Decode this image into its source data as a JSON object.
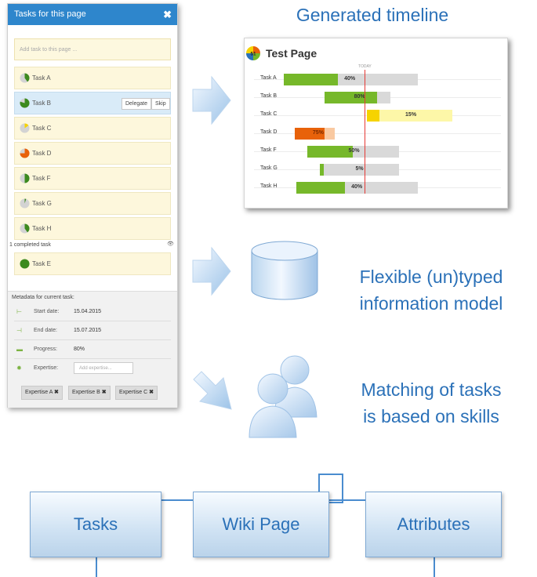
{
  "panel": {
    "title": "Tasks for this page",
    "add_placeholder": "Add task to this page ...",
    "tasks": [
      {
        "name": "Task A",
        "progress": 40
      },
      {
        "name": "Task B",
        "progress": 80,
        "delegate": "Delegate",
        "skip": "Skip"
      },
      {
        "name": "Task C",
        "progress": 15
      },
      {
        "name": "Task D",
        "progress": 75
      },
      {
        "name": "Task F",
        "progress": 50
      },
      {
        "name": "Task G",
        "progress": 5
      },
      {
        "name": "Task H",
        "progress": 40
      }
    ],
    "completed_label": "1 completed task",
    "completed_task": {
      "name": "Task E",
      "progress": 100
    },
    "meta": {
      "title": "Metadata for current task:",
      "start_label": "Start date:",
      "start_value": "15.04.2015",
      "end_label": "End date:",
      "end_value": "15.07.2015",
      "progress_label": "Progress:",
      "progress_value": "80%",
      "expertise_label": "Expertise:",
      "expertise_placeholder": "Add expertise...",
      "tags": [
        "Expertise A",
        "Expertise B",
        "Expertise C"
      ]
    }
  },
  "headings": {
    "timeline": "Generated timeline",
    "model_line1": "Flexible (un)typed",
    "model_line2": "information model",
    "skills_line1": "Matching of tasks",
    "skills_line2": "is based on skills"
  },
  "timeline": {
    "title": "Test Page",
    "badge": "51",
    "today_label": "TODAY",
    "tasks": [
      {
        "name": "Task A",
        "start": 0.0,
        "end": 0.63,
        "progress": 40,
        "label": "40%",
        "bar": "#76b82a",
        "track": "#d9d9d9"
      },
      {
        "name": "Task B",
        "start": 0.19,
        "end": 0.5,
        "progress": 80,
        "label": "80%",
        "bar": "#76b82a",
        "track": "#d9d9d9"
      },
      {
        "name": "Task C",
        "start": 0.39,
        "end": 0.79,
        "progress": 15,
        "label": "15%",
        "bar": "#f6d300",
        "track": "#fdf7a8"
      },
      {
        "name": "Task D",
        "start": 0.05,
        "end": 0.24,
        "progress": 75,
        "label": "75%",
        "bar": "#e8620a",
        "track": "#f9c9a1"
      },
      {
        "name": "Task F",
        "start": 0.11,
        "end": 0.54,
        "progress": 50,
        "label": "50%",
        "bar": "#76b82a",
        "track": "#d9d9d9"
      },
      {
        "name": "Task G",
        "start": 0.17,
        "end": 0.54,
        "progress": 5,
        "label": "5%",
        "bar": "#76b82a",
        "track": "#d9d9d9"
      },
      {
        "name": "Task H",
        "start": 0.06,
        "end": 0.63,
        "progress": 40,
        "label": "40%",
        "bar": "#76b82a",
        "track": "#d9d9d9"
      }
    ]
  },
  "diagram": {
    "tasks": "Tasks",
    "wiki": "Wiki Page",
    "attributes": "Attributes"
  },
  "colors": {
    "accent": "#2b71b8",
    "header": "#2e86cc",
    "today": "#e53935",
    "green": "#76b82a"
  }
}
